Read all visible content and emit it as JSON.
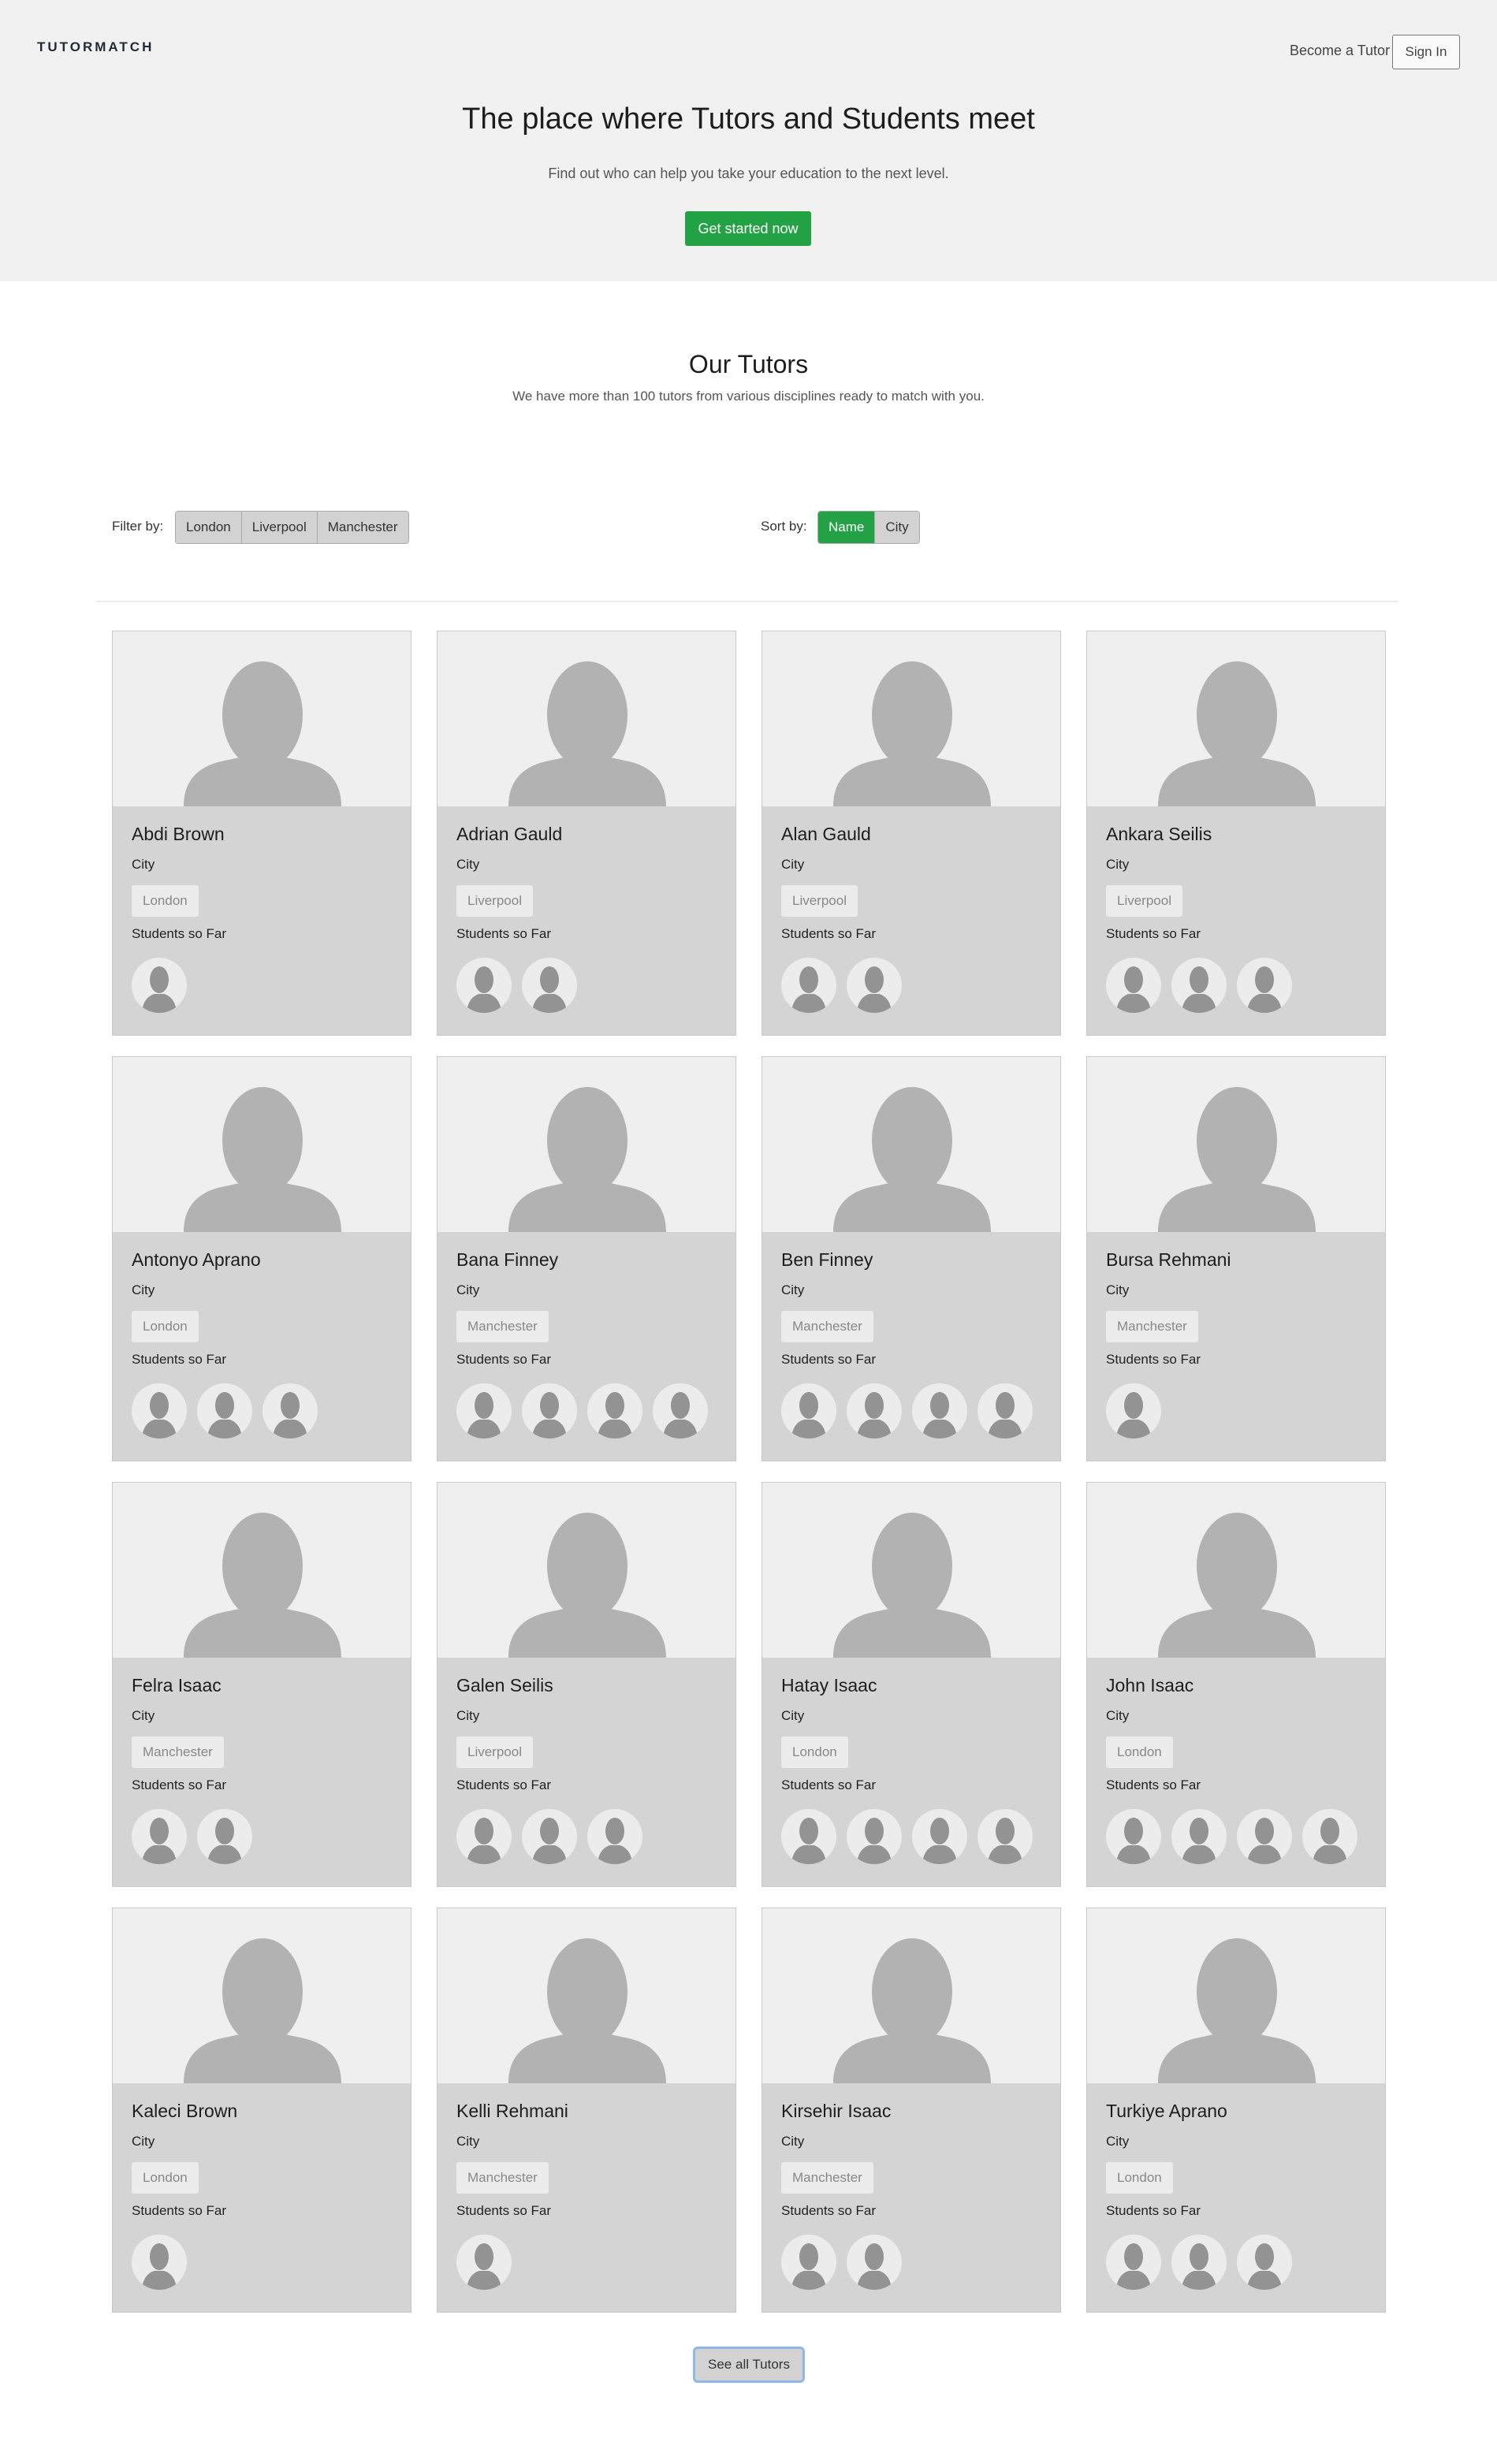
{
  "header": {
    "logo": "TUTORMATCH",
    "become_tutor": "Become a Tutor",
    "sign_in": "Sign In"
  },
  "hero": {
    "title": "The place where Tutors and Students meet",
    "subtitle": "Find out who can help you take your education to the next level.",
    "cta": "Get started now"
  },
  "section": {
    "title": "Our Tutors",
    "subtitle": "We have more than 100 tutors from various disciplines ready to match with you."
  },
  "filter": {
    "label": "Filter by:",
    "options": [
      "London",
      "Liverpool",
      "Manchester"
    ]
  },
  "sort": {
    "label": "Sort by:",
    "options": [
      "Name",
      "City"
    ],
    "active": "Name"
  },
  "card_labels": {
    "city": "City",
    "students": "Students so Far"
  },
  "colors": {
    "accent": "#23a245",
    "hero_bg": "#f1f1f1",
    "card_bg": "#d4d4d4"
  },
  "tutors": [
    {
      "name": "Abdi Brown",
      "city": "London",
      "students": 1
    },
    {
      "name": "Adrian Gauld",
      "city": "Liverpool",
      "students": 2
    },
    {
      "name": "Alan Gauld",
      "city": "Liverpool",
      "students": 2
    },
    {
      "name": "Ankara Seilis",
      "city": "Liverpool",
      "students": 3
    },
    {
      "name": "Antonyo Aprano",
      "city": "London",
      "students": 3
    },
    {
      "name": "Bana Finney",
      "city": "Manchester",
      "students": 4
    },
    {
      "name": "Ben Finney",
      "city": "Manchester",
      "students": 4
    },
    {
      "name": "Bursa Rehmani",
      "city": "Manchester",
      "students": 1
    },
    {
      "name": "Felra Isaac",
      "city": "Manchester",
      "students": 2
    },
    {
      "name": "Galen Seilis",
      "city": "Liverpool",
      "students": 3
    },
    {
      "name": "Hatay Isaac",
      "city": "London",
      "students": 4
    },
    {
      "name": "John Isaac",
      "city": "London",
      "students": 4
    },
    {
      "name": "Kaleci Brown",
      "city": "London",
      "students": 1
    },
    {
      "name": "Kelli Rehmani",
      "city": "Manchester",
      "students": 1
    },
    {
      "name": "Kirsehir Isaac",
      "city": "Manchester",
      "students": 2
    },
    {
      "name": "Turkiye Aprano",
      "city": "London",
      "students": 3
    }
  ],
  "see_all": "See all Tutors"
}
